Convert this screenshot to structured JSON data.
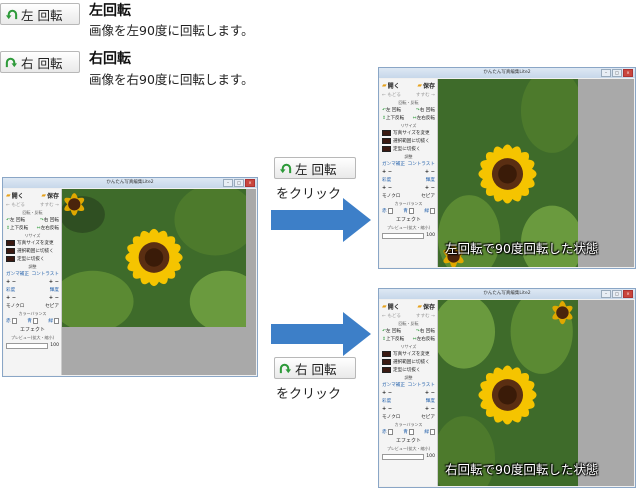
{
  "legend": {
    "left": {
      "button_label": "左 回転",
      "title": "左回転",
      "desc": "画像を左90度に回転します。"
    },
    "right": {
      "button_label": "右 回転",
      "title": "右回転",
      "desc": "画像を右90度に回転します。"
    }
  },
  "steps": {
    "left_button_label": "左 回転",
    "left_click_label": "をクリック",
    "right_button_label": "右 回転",
    "right_click_label": "をクリック"
  },
  "app": {
    "window_title": "かんたん写真編集Lite2",
    "open": "開く",
    "save": "保存",
    "undo": "もどる",
    "redo": "すすむ",
    "rotate_flip_heading": "回転・反転",
    "rotate_left": "左 回転",
    "rotate_right": "右 回転",
    "flip_vertical": "上下反転",
    "flip_horizontal": "左右反転",
    "resize_heading": "リサイズ",
    "resize_photo": "写真サイズを変更",
    "crop_selection": "選択範囲に切抜く",
    "crop_fixed": "定型に切抜く",
    "adjust_heading": "調整",
    "gamma": "ガンマ補正",
    "contrast": "コントラスト",
    "brightness": "彩度",
    "lightness": "輝度",
    "plus_minus": "+ −",
    "mono": "モノクロ",
    "sepia": "セピア",
    "color_balance_heading": "カラーバランス",
    "red": "赤",
    "green": "青",
    "blue": "緑",
    "effect": "エフェクト",
    "preview_scale": "プレビュー(拡大・縮小)",
    "zoom_value": "100"
  },
  "results": {
    "left_status": "左回転で90度回転した状態",
    "right_status": "右回転で90度回転した状態"
  },
  "colors": {
    "arrow": "#3d7fc8",
    "rotate_icon": "#2e9a3a"
  }
}
